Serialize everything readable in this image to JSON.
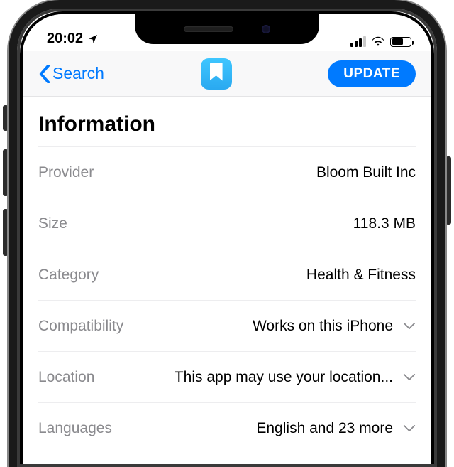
{
  "status": {
    "time": "20:02"
  },
  "nav": {
    "back_label": "Search",
    "update_label": "UPDATE"
  },
  "section_heading": "Information",
  "rows": {
    "provider": {
      "label": "Provider",
      "value": "Bloom Built Inc",
      "expandable": false
    },
    "size": {
      "label": "Size",
      "value": "118.3 MB",
      "expandable": false
    },
    "category": {
      "label": "Category",
      "value": "Health & Fitness",
      "expandable": false
    },
    "compatibility": {
      "label": "Compatibility",
      "value": "Works on this iPhone",
      "expandable": true
    },
    "location": {
      "label": "Location",
      "value": "This app may use your location...",
      "expandable": true
    },
    "languages": {
      "label": "Languages",
      "value": "English and 23 more",
      "expandable": true
    }
  }
}
